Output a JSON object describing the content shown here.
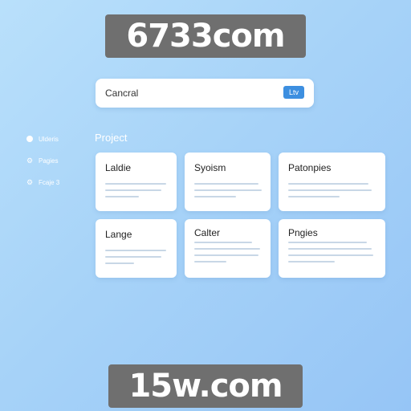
{
  "watermark": {
    "top": "6733com",
    "bottom": "15w.com"
  },
  "search": {
    "value": "Cancral",
    "button_label": "Ltv"
  },
  "sidebar": {
    "items": [
      {
        "label": "Ulderis",
        "icon": "circle-icon"
      },
      {
        "label": "Pagies",
        "icon": "gear-icon"
      },
      {
        "label": "Fcaje 3",
        "icon": "settings-icon"
      }
    ]
  },
  "main": {
    "section_title": "Project",
    "cards": [
      {
        "title": "Laldie"
      },
      {
        "title": "Syoism"
      },
      {
        "title": "Patonpies"
      },
      {
        "title": "Lange"
      },
      {
        "title": "Calter"
      },
      {
        "title": "Pngies"
      }
    ]
  }
}
